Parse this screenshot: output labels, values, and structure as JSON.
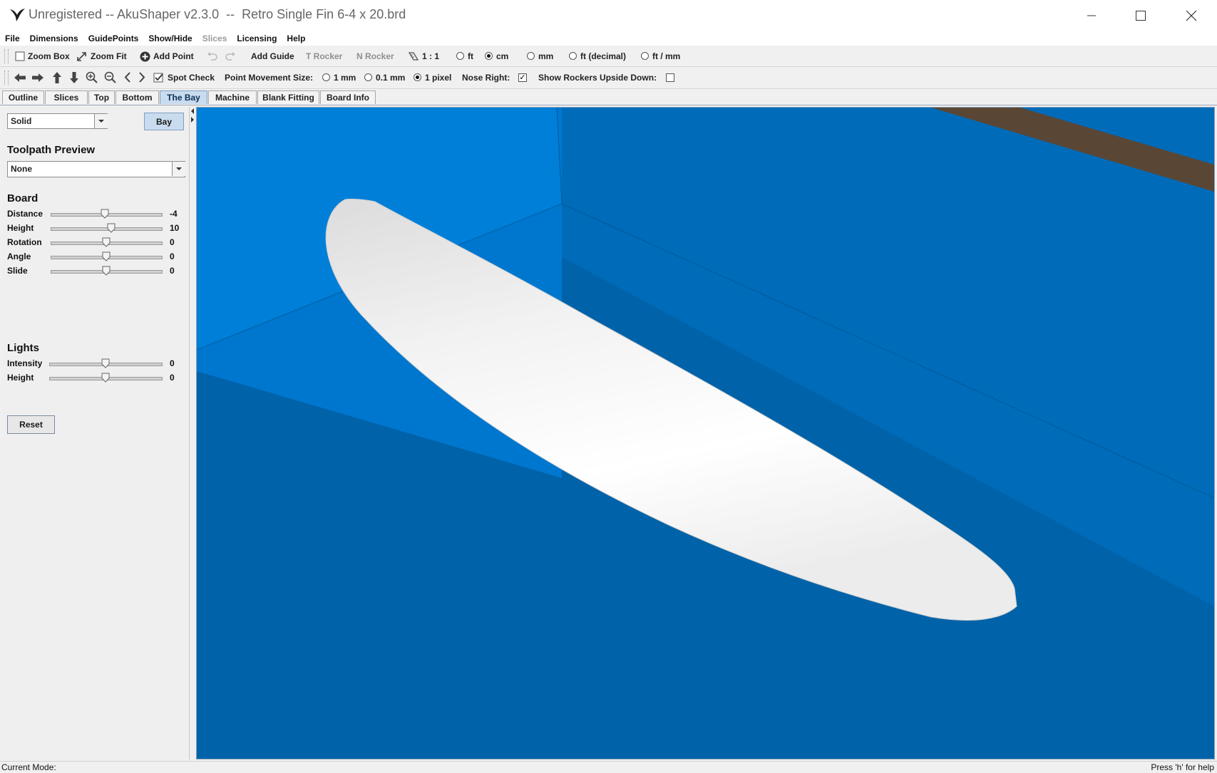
{
  "window": {
    "title": "Unregistered -- AkuShaper v2.3.0  --  Retro Single Fin 6-4 x 20.brd",
    "controls": {
      "minimize": "minimize",
      "maximize": "maximize",
      "close": "close"
    }
  },
  "menu": [
    {
      "label": "File",
      "enabled": true
    },
    {
      "label": "Dimensions",
      "enabled": true
    },
    {
      "label": "GuidePoints",
      "enabled": true
    },
    {
      "label": "Show/Hide",
      "enabled": true
    },
    {
      "label": "Slices",
      "enabled": false
    },
    {
      "label": "Licensing",
      "enabled": true
    },
    {
      "label": "Help",
      "enabled": true
    }
  ],
  "toolbar1": {
    "zoom_box": "Zoom Box",
    "zoom_fit": "Zoom Fit",
    "add_point": "Add Point",
    "add_guide": "Add Guide",
    "t_rocker": "T Rocker",
    "n_rocker": "N Rocker",
    "scale": "1 : 1",
    "units": [
      {
        "label": "ft",
        "selected": false
      },
      {
        "label": "cm",
        "selected": true
      },
      {
        "label": "mm",
        "selected": false
      },
      {
        "label": "ft (decimal)",
        "selected": false
      },
      {
        "label": "ft / mm",
        "selected": false
      }
    ]
  },
  "toolbar2": {
    "spot_check": "Spot Check",
    "spot_check_checked": true,
    "point_movement_label": "Point Movement Size:",
    "movement_sizes": [
      {
        "label": "1 mm",
        "selected": false
      },
      {
        "label": "0.1 mm",
        "selected": false
      },
      {
        "label": "1 pixel",
        "selected": true
      }
    ],
    "nose_right_label": "Nose Right:",
    "nose_right_checked": true,
    "show_rockers_label": "Show Rockers Upside Down:",
    "show_rockers_checked": false
  },
  "tabs": [
    {
      "label": "Outline",
      "active": false
    },
    {
      "label": "Slices",
      "active": false
    },
    {
      "label": "Top",
      "active": false
    },
    {
      "label": "Bottom",
      "active": false
    },
    {
      "label": "The Bay",
      "active": true
    },
    {
      "label": "Machine",
      "active": false
    },
    {
      "label": "Blank Fitting",
      "active": false
    },
    {
      "label": "Board Info",
      "active": false
    }
  ],
  "panel": {
    "render_mode": "Solid",
    "bay_button": "Bay",
    "toolpath_title": "Toolpath Preview",
    "toolpath_value": "None",
    "board_title": "Board",
    "board_sliders": [
      {
        "label": "Distance",
        "value": "-4",
        "fraction": 0.49
      },
      {
        "label": "Height",
        "value": "10",
        "fraction": 0.55
      },
      {
        "label": "Rotation",
        "value": "0",
        "fraction": 0.5
      },
      {
        "label": "Angle",
        "value": "0",
        "fraction": 0.5
      },
      {
        "label": "Slide",
        "value": "0",
        "fraction": 0.5
      }
    ],
    "lights_title": "Lights",
    "light_sliders": [
      {
        "label": "Intensity",
        "value": "0",
        "fraction": 0.5
      },
      {
        "label": "Height",
        "value": "0",
        "fraction": 0.5
      }
    ],
    "reset_button": "Reset"
  },
  "status": {
    "mode_label": "Current Mode:",
    "help_hint": "Press 'h' for help"
  },
  "colors": {
    "viewport_floor": "#0062a8",
    "viewport_wall": "#0077cf",
    "tab_active": "#c9dbee",
    "board": "#f4f4f4",
    "beam": "#5a4634"
  }
}
